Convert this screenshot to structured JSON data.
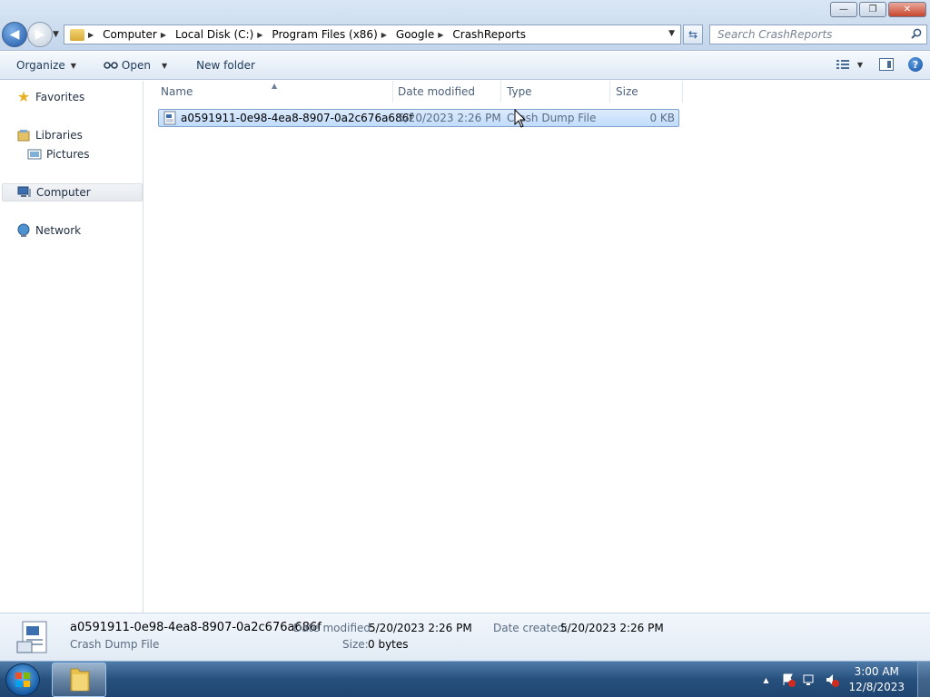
{
  "window": {
    "controls": {
      "minimize": "—",
      "maximize": "❐",
      "close": "✕"
    }
  },
  "address": {
    "breadcrumbs": [
      "Computer",
      "Local Disk (C:)",
      "Program Files (x86)",
      "Google",
      "CrashReports"
    ]
  },
  "search": {
    "placeholder": "Search CrashReports"
  },
  "toolbar": {
    "organize": "Organize",
    "open": "Open",
    "new_folder": "New folder"
  },
  "nav": {
    "favorites": "Favorites",
    "libraries": "Libraries",
    "pictures": "Pictures",
    "computer": "Computer",
    "network": "Network"
  },
  "columns": {
    "name": "Name",
    "date_modified": "Date modified",
    "type": "Type",
    "size": "Size"
  },
  "files": [
    {
      "name": "a0591911-0e98-4ea8-8907-0a2c676a686f",
      "date_modified": "5/20/2023 2:26 PM",
      "type": "Crash Dump File",
      "size": "0 KB"
    }
  ],
  "details": {
    "name": "a0591911-0e98-4ea8-8907-0a2c676a686f",
    "type": "Crash Dump File",
    "date_modified_label": "Date modified:",
    "date_modified": "5/20/2023 2:26 PM",
    "date_created_label": "Date created:",
    "date_created": "5/20/2023 2:26 PM",
    "size_label": "Size:",
    "size": "0 bytes"
  },
  "taskbar": {
    "time": "3:00 AM",
    "date": "12/8/2023",
    "tray_arrow": "▲"
  },
  "icons": {
    "back": "◀",
    "forward": "▶",
    "caret": "▼",
    "crumb_sep": "▶",
    "refresh": "⇆",
    "help": "?",
    "sort": "▲",
    "star": "★"
  }
}
